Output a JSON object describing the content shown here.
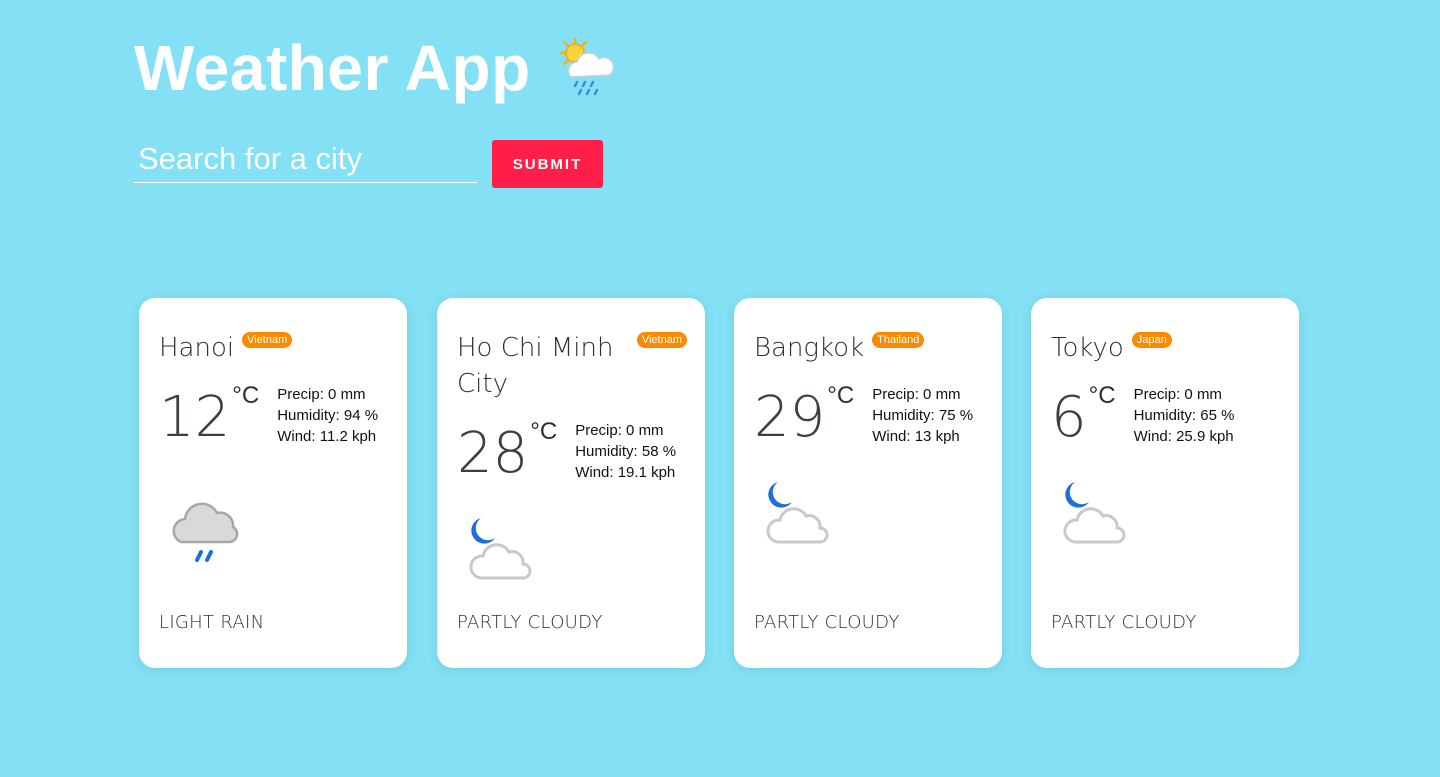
{
  "header": {
    "title": "Weather App",
    "icon": "sun-cloud-rain-icon"
  },
  "search": {
    "placeholder": "Search for a city",
    "value": "",
    "submit_label": "SUBMIT"
  },
  "colors": {
    "background": "#84e0f4",
    "submit": "#ff1e47",
    "badge": "#fa8a00",
    "card": "#ffffff"
  },
  "cards": [
    {
      "city": "Hanoi",
      "country": "Vietnam",
      "temp": "12",
      "unit": "°C",
      "precip": "Precip: 0 mm",
      "humidity": "Humidity: 94 %",
      "wind": "Wind: 11.2 kph",
      "icon": "light-rain-icon",
      "condition": "LIGHT RAIN"
    },
    {
      "city": "Ho Chi Minh City",
      "country": "Vietnam",
      "temp": "28",
      "unit": "°C",
      "precip": "Precip: 0 mm",
      "humidity": "Humidity: 58 %",
      "wind": "Wind: 19.1 kph",
      "icon": "partly-cloudy-night-icon",
      "condition": "PARTLY CLOUDY"
    },
    {
      "city": "Bangkok",
      "country": "Thailand",
      "temp": "29",
      "unit": "°C",
      "precip": "Precip: 0 mm",
      "humidity": "Humidity: 75 %",
      "wind": "Wind: 13 kph",
      "icon": "partly-cloudy-night-icon",
      "condition": "PARTLY CLOUDY"
    },
    {
      "city": "Tokyo",
      "country": "Japan",
      "temp": "6",
      "unit": "°C",
      "precip": "Precip: 0 mm",
      "humidity": "Humidity: 65 %",
      "wind": "Wind: 25.9 kph",
      "icon": "partly-cloudy-night-icon",
      "condition": "PARTLY CLOUDY"
    }
  ]
}
